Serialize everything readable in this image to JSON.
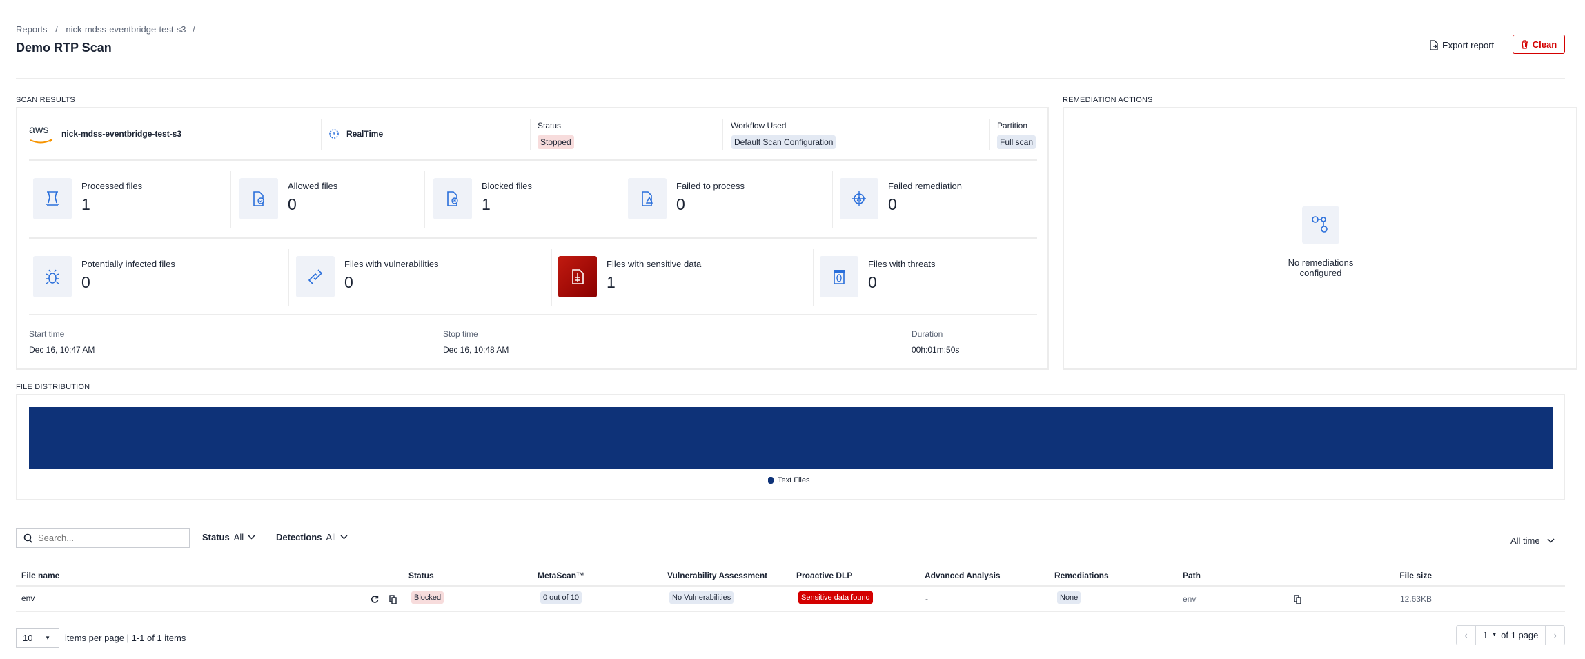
{
  "breadcrumb": {
    "items": [
      "Reports",
      "nick-mdss-eventbridge-test-s3"
    ],
    "separator": "/"
  },
  "header": {
    "title": "Demo RTP Scan",
    "export_label": "Export report",
    "clean_label": "Clean"
  },
  "scan_results": {
    "section_label": "SCAN RESULTS",
    "source_name": "nick-mdss-eventbridge-test-s3",
    "source_logo": "aws",
    "mode": "RealTime",
    "status_label": "Status",
    "status_value": "Stopped",
    "workflow_label": "Workflow Used",
    "workflow_value": "Default Scan Configuration",
    "partition_label": "Partition",
    "partition_value": "Full scan",
    "stats_row1": [
      {
        "label": "Processed files",
        "value": "1",
        "icon": "processed-icon"
      },
      {
        "label": "Allowed files",
        "value": "0",
        "icon": "allowed-file-icon"
      },
      {
        "label": "Blocked files",
        "value": "1",
        "icon": "blocked-file-icon"
      },
      {
        "label": "Failed to process",
        "value": "0",
        "icon": "failed-process-icon"
      },
      {
        "label": "Failed remediation",
        "value": "0",
        "icon": "failed-remediation-icon"
      }
    ],
    "stats_row2": [
      {
        "label": "Potentially infected files",
        "value": "0",
        "icon": "bug-icon"
      },
      {
        "label": "Files with vulnerabilities",
        "value": "0",
        "icon": "link-icon"
      },
      {
        "label": "Files with sensitive data",
        "value": "1",
        "icon": "sensitive-data-icon"
      },
      {
        "label": "Files with threats",
        "value": "0",
        "icon": "threat-jar-icon"
      }
    ],
    "start_label": "Start time",
    "start_value": "Dec 16, 10:47 AM",
    "stop_label": "Stop time",
    "stop_value": "Dec 16, 10:48 AM",
    "duration_label": "Duration",
    "duration_value": "00h:01m:50s"
  },
  "remediation": {
    "section_label": "REMEDIATION ACTIONS",
    "empty_text": "No remediations configured"
  },
  "chart_data": {
    "type": "bar",
    "title": "FILE DISTRIBUTION",
    "orientation": "horizontal-stacked",
    "categories": [
      "Text Files"
    ],
    "values": [
      1
    ],
    "colors": [
      "#0e3278"
    ],
    "legend": "bottom-center"
  },
  "filters": {
    "search_placeholder": "Search...",
    "status_label": "Status",
    "status_value": "All",
    "detections_label": "Detections",
    "detections_value": "All",
    "time_value": "All time"
  },
  "table": {
    "columns": [
      "File name",
      "Status",
      "MetaScan™",
      "Vulnerability Assessment",
      "Proactive DLP",
      "Advanced Analysis",
      "Remediations",
      "Path",
      "File size"
    ],
    "rows": [
      {
        "file_name": "env",
        "status": "Blocked",
        "metascan": "0 out of 10",
        "vulnerability": "No Vulnerabilities",
        "dlp": "Sensitive data found",
        "advanced": "-",
        "remediations": "None",
        "path": "env",
        "size": "12.63KB"
      }
    ]
  },
  "pagination": {
    "per_page": "10",
    "per_page_text": "items per page | 1-1 of 1 items",
    "page": "1",
    "of_pages": "of 1 page"
  }
}
